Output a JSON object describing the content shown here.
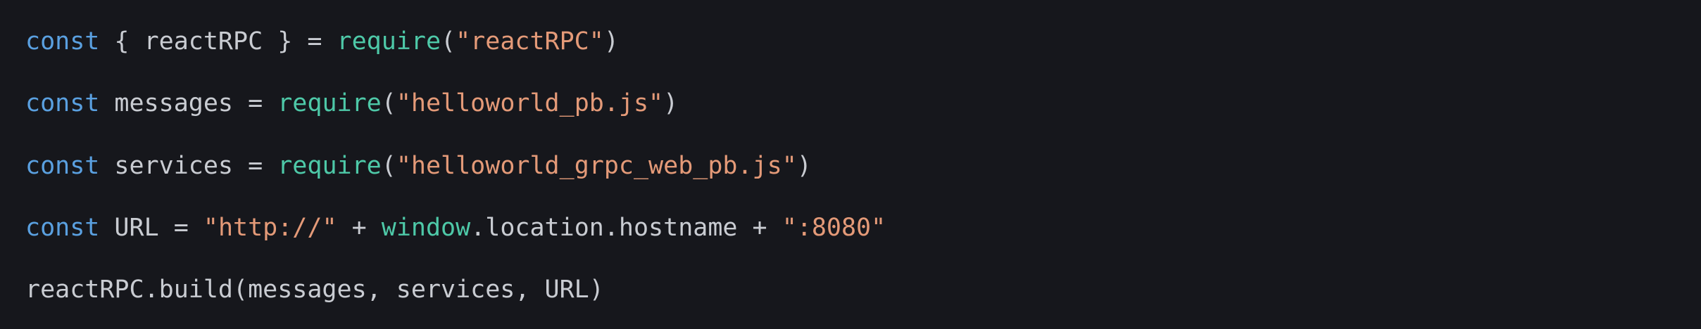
{
  "colors": {
    "background": "#16171c",
    "keyword": "#5aa0e0",
    "function": "#4ec9a8",
    "string": "#e49a78",
    "plain": "#c9ccd2"
  },
  "lines": [
    {
      "kw": "const",
      "p1": " { reactRPC } = ",
      "fn": "require",
      "p2": "(",
      "str": "\"reactRPC\"",
      "p3": ")"
    },
    {
      "kw": "const",
      "p1": " messages = ",
      "fn": "require",
      "p2": "(",
      "str": "\"helloworld_pb.js\"",
      "p3": ")"
    },
    {
      "kw": "const",
      "p1": " services = ",
      "fn": "require",
      "p2": "(",
      "str": "\"helloworld_grpc_web_pb.js\"",
      "p3": ")"
    },
    {
      "kw": "const",
      "p1": " URL = ",
      "str1": "\"http://\"",
      "p2": " + ",
      "fn": "window",
      "p3": ".location.hostname + ",
      "str2": "\":8080\""
    },
    {
      "plain": "reactRPC.build(messages, services, URL)"
    }
  ]
}
